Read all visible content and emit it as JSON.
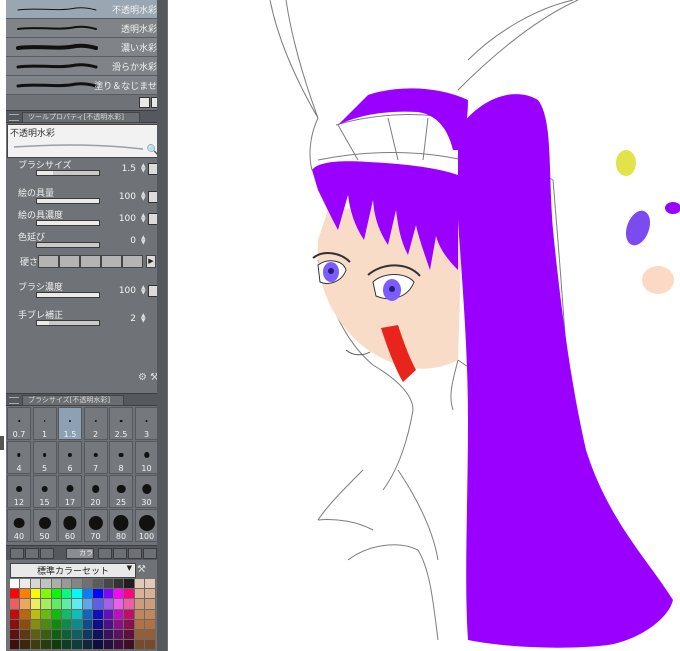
{
  "brush_list": {
    "items": [
      {
        "label": "不透明水彩",
        "selected": true,
        "weight": 1
      },
      {
        "label": "透明水彩",
        "selected": false,
        "weight": 2
      },
      {
        "label": "濃い水彩",
        "selected": false,
        "weight": 4
      },
      {
        "label": "滑らか水彩",
        "selected": false,
        "weight": 3
      },
      {
        "label": "塗り＆なじませ",
        "selected": false,
        "weight": 3
      }
    ],
    "footer_icons": [
      "duplicate-icon",
      "trash-icon"
    ]
  },
  "tool_property": {
    "header": "ツールプロパティ[不透明水彩]",
    "preview_label": "不透明水彩",
    "preview_icon": "magnifier-icon",
    "properties": [
      {
        "id": "brush-size",
        "label": "ブラシサイズ",
        "value": "1.5",
        "fraction": 0.25,
        "icon": "pressure-icon"
      },
      {
        "id": "paint-amount",
        "label": "絵の具量",
        "value": "100",
        "fraction": 1.0,
        "icon": "pressure-icon"
      },
      {
        "id": "paint-density",
        "label": "絵の具濃度",
        "value": "100",
        "fraction": 1.0,
        "icon": "lock-icon"
      },
      {
        "id": "color-stretch",
        "label": "色延び",
        "value": "0",
        "fraction": 0.0,
        "icon": ""
      },
      {
        "id": "brush-density",
        "label": "ブラシ濃度",
        "value": "100",
        "fraction": 1.0,
        "icon": "pressure-icon"
      },
      {
        "id": "stabilization",
        "label": "手ブレ補正",
        "value": "2",
        "fraction": 0.2,
        "icon": ""
      }
    ],
    "hardness": {
      "label": "硬さ"
    }
  },
  "brush_size_panel": {
    "header": "ブラシサイズ[不透明水彩]",
    "sizes": [
      "0.7",
      "1",
      "1.5",
      "2",
      "2.5",
      "3",
      "4",
      "5",
      "6",
      "7",
      "8",
      "10",
      "12",
      "15",
      "17",
      "20",
      "25",
      "30",
      "40",
      "50",
      "60",
      "70",
      "80",
      "100"
    ],
    "selected": "1.5"
  },
  "color_panel": {
    "active_tab": "カラ",
    "color_set": "標準カラーセット"
  },
  "colors": {
    "hair": "#9a00ff",
    "skin": "#f9dcc8",
    "mouth": "#e8241c",
    "eye": "#7a5cff",
    "dot_yellow": "#e2e24a",
    "dot_purple": "#7b4bf0",
    "dot_skin": "#fbd9c5"
  }
}
